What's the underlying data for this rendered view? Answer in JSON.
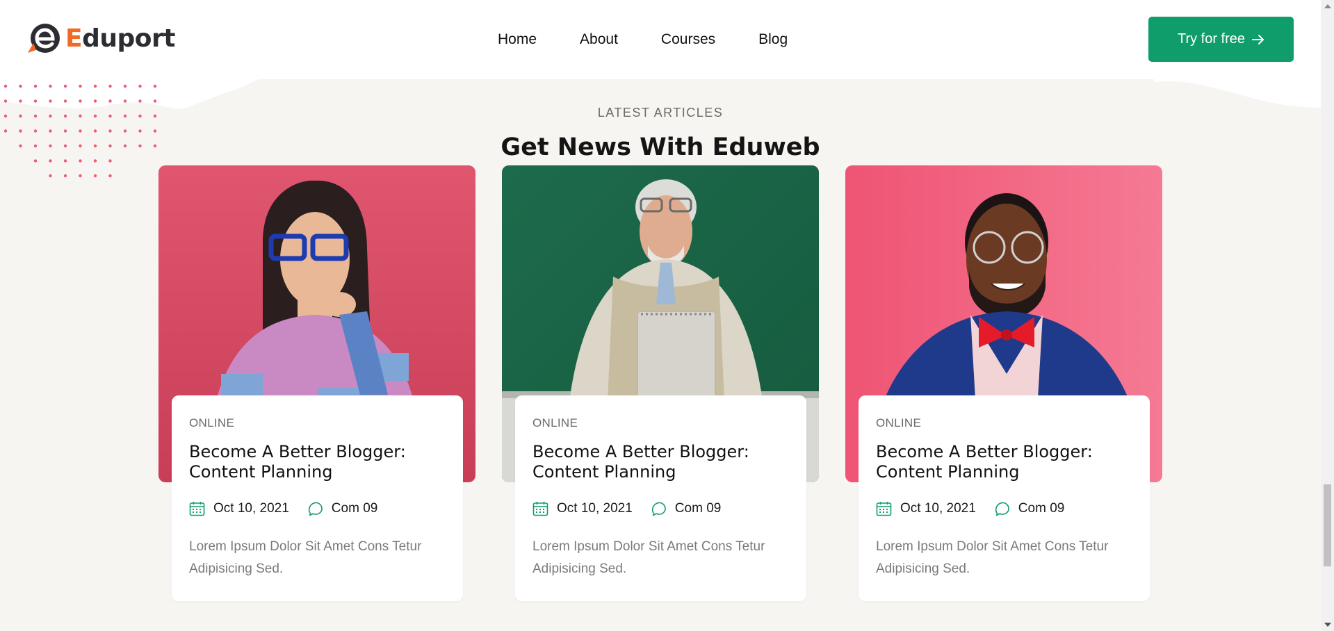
{
  "header": {
    "logo_letter": "E",
    "logo_rest": "duport",
    "nav": [
      {
        "label": "Home"
      },
      {
        "label": "About"
      },
      {
        "label": "Courses"
      },
      {
        "label": "Blog"
      }
    ],
    "cta_label": "Try for free"
  },
  "section": {
    "eyebrow": "LATEST ARTICLES",
    "title": "Get News With Eduweb"
  },
  "cards": [
    {
      "category": "ONLINE",
      "title": "Become A Better Blogger: Content Planning",
      "date": "Oct 10, 2021",
      "comments": "Com 09",
      "excerpt": "Lorem Ipsum Dolor Sit Amet Cons Tetur Adipisicing Sed."
    },
    {
      "category": "ONLINE",
      "title": "Become A Better Blogger: Content Planning",
      "date": "Oct 10, 2021",
      "comments": "Com 09",
      "excerpt": "Lorem Ipsum Dolor Sit Amet Cons Tetur Adipisicing Sed."
    },
    {
      "category": "ONLINE",
      "title": "Become A Better Blogger: Content Planning",
      "date": "Oct 10, 2021",
      "comments": "Com 09",
      "excerpt": "Lorem Ipsum Dolor Sit Amet Cons Tetur Adipisicing Sed."
    }
  ],
  "colors": {
    "brand_green": "#0f9d6b",
    "logo_orange": "#f06a26",
    "dot_red": "#ee5b6e",
    "background": "#f7f5f2"
  },
  "icons": [
    "logo-mark-icon",
    "arrow-right-icon",
    "calendar-icon",
    "chat-bubble-icon"
  ]
}
